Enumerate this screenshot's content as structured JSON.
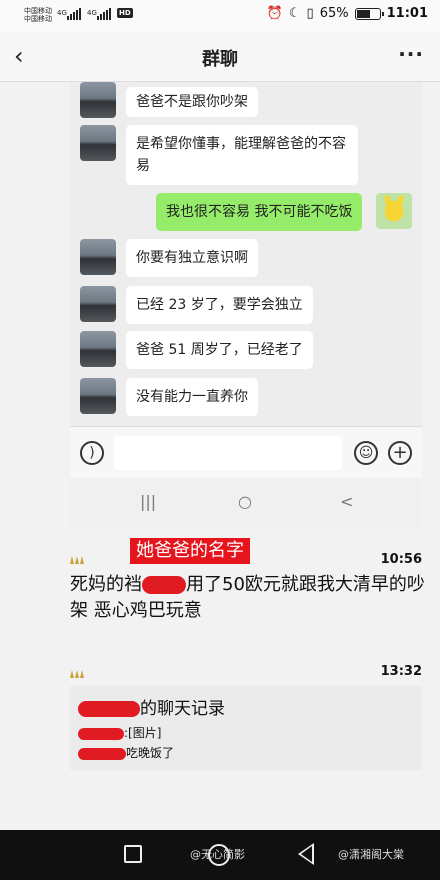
{
  "status": {
    "carrier_1": "中国移动",
    "carrier_2": "中国移动",
    "sig_1": "4G",
    "sig_2": "4G",
    "hd": "HD",
    "battery_percent": "65%",
    "battery_level": 0.65,
    "time": "11:01"
  },
  "header": {
    "title": "群聊",
    "back_icon": "chevron-left-icon",
    "more_icon": "more-icon"
  },
  "chat": {
    "messages": [
      {
        "side": "left",
        "text": "爸爸不是跟你吵架"
      },
      {
        "side": "left",
        "text": "是希望你懂事，能理解爸爸的不容易"
      },
      {
        "side": "right",
        "text": "我也很不容易 我不可能不吃饭"
      },
      {
        "side": "left",
        "text": "你要有独立意识啊"
      },
      {
        "side": "left",
        "text": "已经 23 岁了，要学会独立"
      },
      {
        "side": "left",
        "text": "爸爸 51 周岁了，已经老了"
      },
      {
        "side": "left",
        "text": "没有能力一直养你"
      }
    ],
    "system_nav": [
      "|||",
      "○",
      "<"
    ]
  },
  "post1": {
    "label": "她爸爸的名字",
    "time": "10:56",
    "text_before": "死妈的",
    "text_visible_partial": "裆",
    "text_after": "用了50欧元就跟我大清早的吵架 恶心鸡巴玩意"
  },
  "post2": {
    "time": "13:32",
    "title_suffix": "的聊天记录",
    "line1": ":[图片]",
    "line2": "吃晚饭了"
  },
  "watermarks": [
    "@无心简影",
    "@潇湘阁大棠"
  ],
  "colors": {
    "my_bubble": "#95ec69",
    "redact": "#e01b22",
    "label_bg": "#e5141d"
  }
}
